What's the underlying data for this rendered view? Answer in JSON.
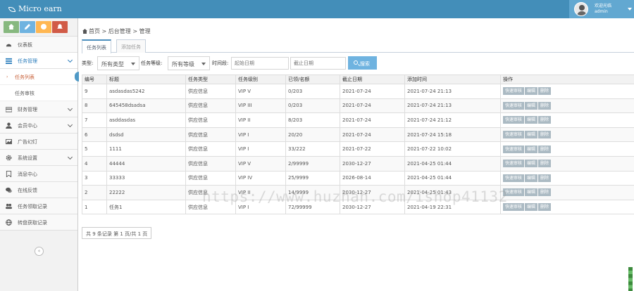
{
  "app": {
    "brand": "Micro earn"
  },
  "user": {
    "welcome": "欢迎光临",
    "name": "admin"
  },
  "sidebar": {
    "items": [
      {
        "label": "仪表板",
        "icon": "dashboard-icon"
      },
      {
        "label": "任务管理",
        "icon": "list-icon",
        "active": true,
        "children": [
          {
            "label": "任务列表",
            "current": true
          },
          {
            "label": "任务审核"
          }
        ]
      },
      {
        "label": "财务管理",
        "icon": "credit-card-icon"
      },
      {
        "label": "会员中心",
        "icon": "user-icon"
      },
      {
        "label": "广告幻灯",
        "icon": "picture-icon"
      },
      {
        "label": "系统设置",
        "icon": "gear-icon"
      },
      {
        "label": "消息中心",
        "icon": "bookmark-icon"
      },
      {
        "label": "在线反馈",
        "icon": "comments-icon"
      },
      {
        "label": "任务领取记录",
        "icon": "group-icon"
      },
      {
        "label": "转盘获取记录",
        "icon": "globe-icon"
      }
    ]
  },
  "breadcrumb": {
    "home": "首页",
    "section": "后台管理",
    "page": "管理"
  },
  "tabs": [
    {
      "label": "任务列表",
      "active": true
    },
    {
      "label": "添加任务"
    }
  ],
  "filter": {
    "type_label": "类型:",
    "type_value": "所有类型",
    "level_label": "任务等级:",
    "level_value": "所有等级",
    "time_label": "时间段:",
    "start_placeholder": "起始日期",
    "end_placeholder": "截止日期",
    "search_label": "搜索"
  },
  "table": {
    "headers": [
      "编号",
      "标题",
      "任务类型",
      "任务级别",
      "已领/名额",
      "截止日期",
      "添加时间",
      "操作"
    ],
    "actions": [
      "快速审核",
      "编辑",
      "删除"
    ],
    "rows": [
      [
        "9",
        "asdasdas5242",
        "供应信息",
        "VIP V",
        "0/203",
        "2021-07-24",
        "2021-07-24 21:13"
      ],
      [
        "8",
        "645458dsadsa",
        "供应信息",
        "VIP III",
        "0/203",
        "2021-07-24",
        "2021-07-24 21:13"
      ],
      [
        "7",
        "asddasdas",
        "供应信息",
        "VIP II",
        "8/203",
        "2021-07-24",
        "2021-07-24 21:12"
      ],
      [
        "6",
        "dsdsd",
        "供应信息",
        "VIP I",
        "20/20",
        "2021-07-24",
        "2021-07-24 15:18"
      ],
      [
        "5",
        "1111",
        "供应信息",
        "VIP I",
        "33/222",
        "2021-07-22",
        "2021-07-22 10:02"
      ],
      [
        "4",
        "44444",
        "供应信息",
        "VIP V",
        "2/99999",
        "2030-12-27",
        "2021-04-25 01:44"
      ],
      [
        "3",
        "33333",
        "供应信息",
        "VIP IV",
        "25/9999",
        "2026-08-14",
        "2021-04-25 01:44"
      ],
      [
        "2",
        "22222",
        "供应信息",
        "VIP II",
        "14/9999",
        "2030-12-27",
        "2021-04-25 01:43"
      ],
      [
        "1",
        "任务1",
        "供应信息",
        "VIP I",
        "72/99999",
        "2030-12-27",
        "2021-04-19 22:31"
      ]
    ]
  },
  "pager": {
    "text": "共 9 条记录 第 1 页/共 1 页"
  },
  "watermark": "https://www.huzhan.com/ishop41132"
}
